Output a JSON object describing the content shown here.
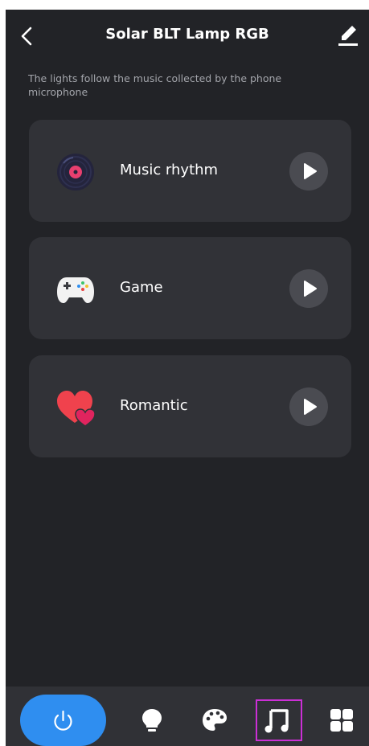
{
  "header": {
    "title": "Solar BLT Lamp RGB",
    "back_icon": "chevron-left-icon",
    "edit_icon": "pencil-icon"
  },
  "subtitle": "The lights follow the music collected by the phone microphone",
  "modes": [
    {
      "label": "Music rhythm",
      "icon": "vinyl-record-icon"
    },
    {
      "label": "Game",
      "icon": "gamepad-icon"
    },
    {
      "label": "Romantic",
      "icon": "hearts-icon"
    }
  ],
  "bottom_nav": {
    "items": [
      "power-icon",
      "bulb-icon",
      "palette-icon",
      "music-note-icon",
      "grid-icon"
    ],
    "active": "music-note-icon"
  },
  "colors": {
    "background": "#222327",
    "card": "#313237",
    "accent_blue": "#2f8ef0",
    "selection_outline": "#cc2fd6"
  }
}
